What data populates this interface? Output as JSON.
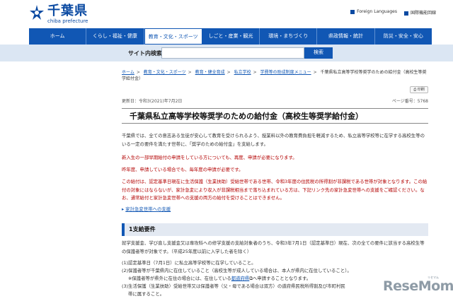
{
  "header": {
    "logo_title": "千葉県",
    "logo_sub": "chiba prefecture",
    "util_links": [
      "Foreign Languages",
      "国際機能回線"
    ]
  },
  "nav": {
    "items": [
      "ホーム",
      "くらし・福祉・健康",
      "教育・文化・スポーツ",
      "しごと・産業・観光",
      "環境・まちづくり",
      "県政情報・統計",
      "防災・安全・安心"
    ],
    "active_index": 2
  },
  "search": {
    "label": "サイト内検索",
    "placeholder": "",
    "button": "検索"
  },
  "breadcrumb": {
    "items": [
      "ホーム",
      "教育・文化・スポーツ",
      "教育・健全育成",
      "私立学校",
      "学費等の助成制度メニュー"
    ],
    "current": "千葉県私立高等学校等奨学のための給付金（高校生等奨学給付金）"
  },
  "print_label": "印刷",
  "meta": {
    "updated": "更新日：令和3(2021)年7月2日",
    "page_no": "ページ番号：5768"
  },
  "title": "千葉県私立高等学校等奨学のための給付金（高校生等奨学給付金）",
  "paragraphs": {
    "intro": "千葉県では、全ての意志ある生徒が安心して教育を受けられるよう、授業料以外の教育費負担を軽減するため、私立高等学校等に在学する高校生等のいる一定の要件を満たす世帯に、「奨学のための給付金」を支給します。",
    "red1": "新入生の一部早期給付の申請をしている方についても、再度、申請が必要になります。",
    "red2": "昨年度、申請している場合でも、毎年度の申請が必要です。",
    "red3": "この給付は、認定基準日現在に生活保護（生業扶助）受給世帯である世帯、令和3年度の住民税の所得割が非課税である世帯が対象となります。この給付の対象にはならないが、家計急変により収入が非課税相当まで落ち込まれている方は、下記リンク先の家計急変世帯への支援をご確認ください。なお、通常給付と家計急変世帯への支援の両方の給付を受けることはできません。"
  },
  "doc_link": "家計急変世帯への支援",
  "section_head": "1支給要件",
  "section_intro": "就学支援金、学び直し支援金又は専攻科への修学支援の支給対象者のうち、令和3年7月1日（認定基準日）現在、次の全ての要件に該当する高校生等の保護者等が対象です。（平成25年度以前に入学した者を除く）",
  "list": {
    "item1": "(1)認定基準日（7月1日）に私立高等学校等に在学していること。",
    "item2": "(2)保護者等が千葉県内に在住していること（高校生等が成人している場合は、本人が県内に在住していること）。",
    "item2_note_pre": "※保護者等が県外に在住の場合には、在住している",
    "item2_note_link": "都道府県",
    "item2_note_post": "へ申請することとなります。",
    "item3": "(3)生活保護（生業扶助）受給世帯又は保護者等（父・母である場合は双方）の道府県民税所得割及び市町村民",
    "item3_cont": "帯に属すること。"
  },
  "watermark": "ReseMom",
  "watermark_sub": "リセマム"
}
